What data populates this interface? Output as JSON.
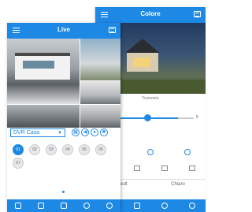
{
  "color_app": {
    "title": "Colore",
    "preset_label": "Tramonto",
    "slider_value_label": "5",
    "slider_level": 0.52,
    "buttons": [
      "fault",
      "Chiaro"
    ]
  },
  "live_app": {
    "title": "Live",
    "device": {
      "selected": "DVR Casa"
    },
    "channels": [
      "01",
      "02",
      "03",
      "04",
      "05",
      "06",
      "07"
    ],
    "active_channel": "01"
  },
  "colors": {
    "accent": "#1e88e5"
  },
  "icons": [
    "menu-icon",
    "cast-icon",
    "chevron-down-icon",
    "grid-icon",
    "playback-icon",
    "capture-icon",
    "settings-icon"
  ]
}
